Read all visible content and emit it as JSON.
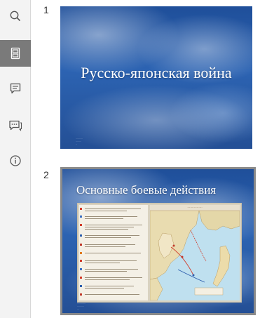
{
  "toolbar": {
    "items": [
      {
        "name": "search",
        "icon": "search-icon",
        "active": false
      },
      {
        "name": "thumbnails",
        "icon": "thumbnails-icon",
        "active": true
      },
      {
        "name": "comments",
        "icon": "comment-icon",
        "active": false
      },
      {
        "name": "chat",
        "icon": "chat-icon",
        "active": false
      },
      {
        "name": "info",
        "icon": "info-icon",
        "active": false
      }
    ],
    "active_color": "#7a7a7a"
  },
  "slides": [
    {
      "number": "1",
      "title": "Русско-японская война",
      "selected": false
    },
    {
      "number": "2",
      "title": "Основные боевые действия",
      "selected": true
    }
  ],
  "colors": {
    "slide_bg": "#2c63b2",
    "selection_border": "#8a8a8a"
  }
}
